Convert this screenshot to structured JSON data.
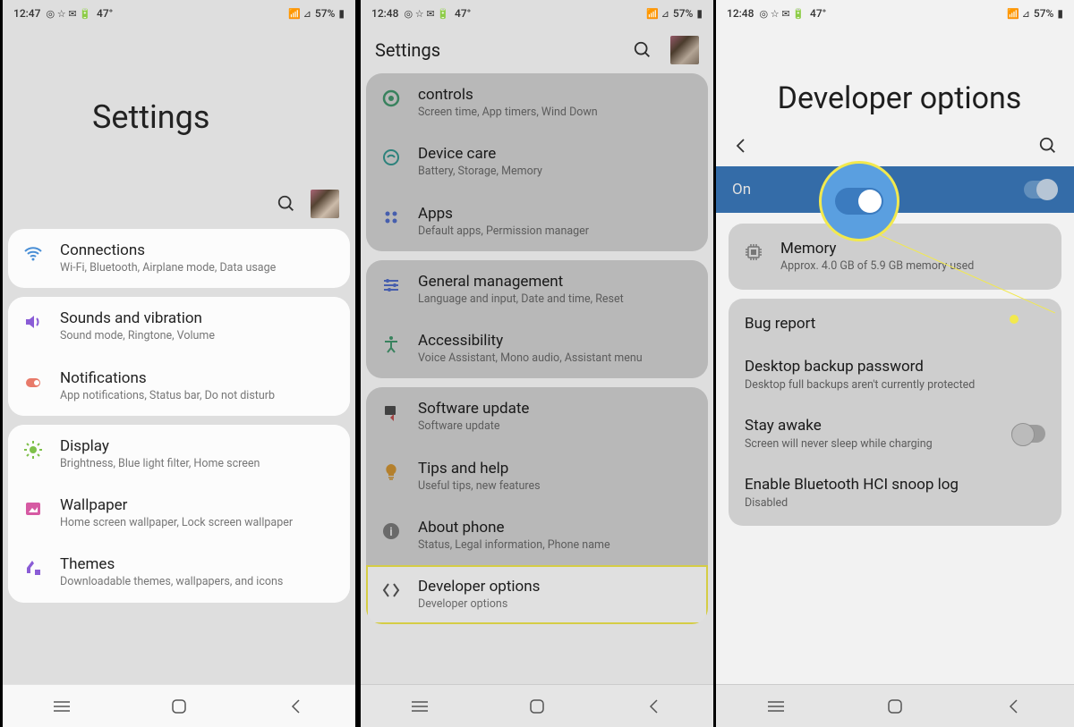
{
  "status": {
    "time1": "12:47",
    "time2": "12:48",
    "temp": "47°",
    "battery": "57%"
  },
  "screen1": {
    "title": "Settings",
    "groups": [
      {
        "items": [
          {
            "icon": "wifi",
            "color": "#4a8fd6",
            "title": "Connections",
            "sub": "Wi-Fi, Bluetooth, Airplane mode, Data usage"
          }
        ]
      },
      {
        "items": [
          {
            "icon": "sound",
            "color": "#8a5cd6",
            "title": "Sounds and vibration",
            "sub": "Sound mode, Ringtone, Volume"
          },
          {
            "icon": "notif",
            "color": "#e87a6a",
            "title": "Notifications",
            "sub": "App notifications, Status bar, Do not disturb"
          }
        ]
      },
      {
        "items": [
          {
            "icon": "display",
            "color": "#7ec04a",
            "title": "Display",
            "sub": "Brightness, Blue light filter, Home screen"
          },
          {
            "icon": "wallpaper",
            "color": "#d65aa3",
            "title": "Wallpaper",
            "sub": "Home screen wallpaper, Lock screen wallpaper"
          },
          {
            "icon": "themes",
            "color": "#8a5cd6",
            "title": "Themes",
            "sub": "Downloadable themes, wallpapers, and icons"
          }
        ]
      }
    ]
  },
  "screen2": {
    "header": "Settings",
    "items": [
      {
        "icon": "wellbeing",
        "color": "#4aa87a",
        "title": "controls",
        "sub": "Screen time, App timers, Wind Down"
      },
      {
        "icon": "devicecare",
        "color": "#3aa8a0",
        "title": "Device care",
        "sub": "Battery, Storage, Memory"
      },
      {
        "icon": "apps",
        "color": "#5a7ae0",
        "title": "Apps",
        "sub": "Default apps, Permission manager"
      },
      {
        "icon": "general",
        "color": "#5a7ae0",
        "title": "General management",
        "sub": "Language and input, Date and time, Reset"
      },
      {
        "icon": "accessibility",
        "color": "#4aa87a",
        "title": "Accessibility",
        "sub": "Voice Assistant, Mono audio, Assistant menu"
      },
      {
        "icon": "update",
        "color": "#d65a5a",
        "title": "Software update",
        "sub": "Software update"
      },
      {
        "icon": "tips",
        "color": "#e8a53a",
        "title": "Tips and help",
        "sub": "Useful tips, new features"
      },
      {
        "icon": "about",
        "color": "#888",
        "title": "About phone",
        "sub": "Status, Legal information, Phone name"
      },
      {
        "icon": "dev",
        "color": "#555",
        "title": "Developer options",
        "sub": "Developer options",
        "hl": true
      }
    ]
  },
  "screen3": {
    "title": "Developer options",
    "on_label": "On",
    "items": [
      {
        "icon": "memory",
        "title": "Memory",
        "sub": "Approx. 4.0 GB of 5.9 GB memory used",
        "card": true
      },
      {
        "title": "Bug report"
      },
      {
        "title": "Desktop backup password",
        "sub": "Desktop full backups aren't currently protected"
      },
      {
        "title": "Stay awake",
        "sub": "Screen will never sleep while charging",
        "toggle": "off"
      },
      {
        "title": "Enable Bluetooth HCI snoop log",
        "sub": "Disabled"
      }
    ]
  }
}
